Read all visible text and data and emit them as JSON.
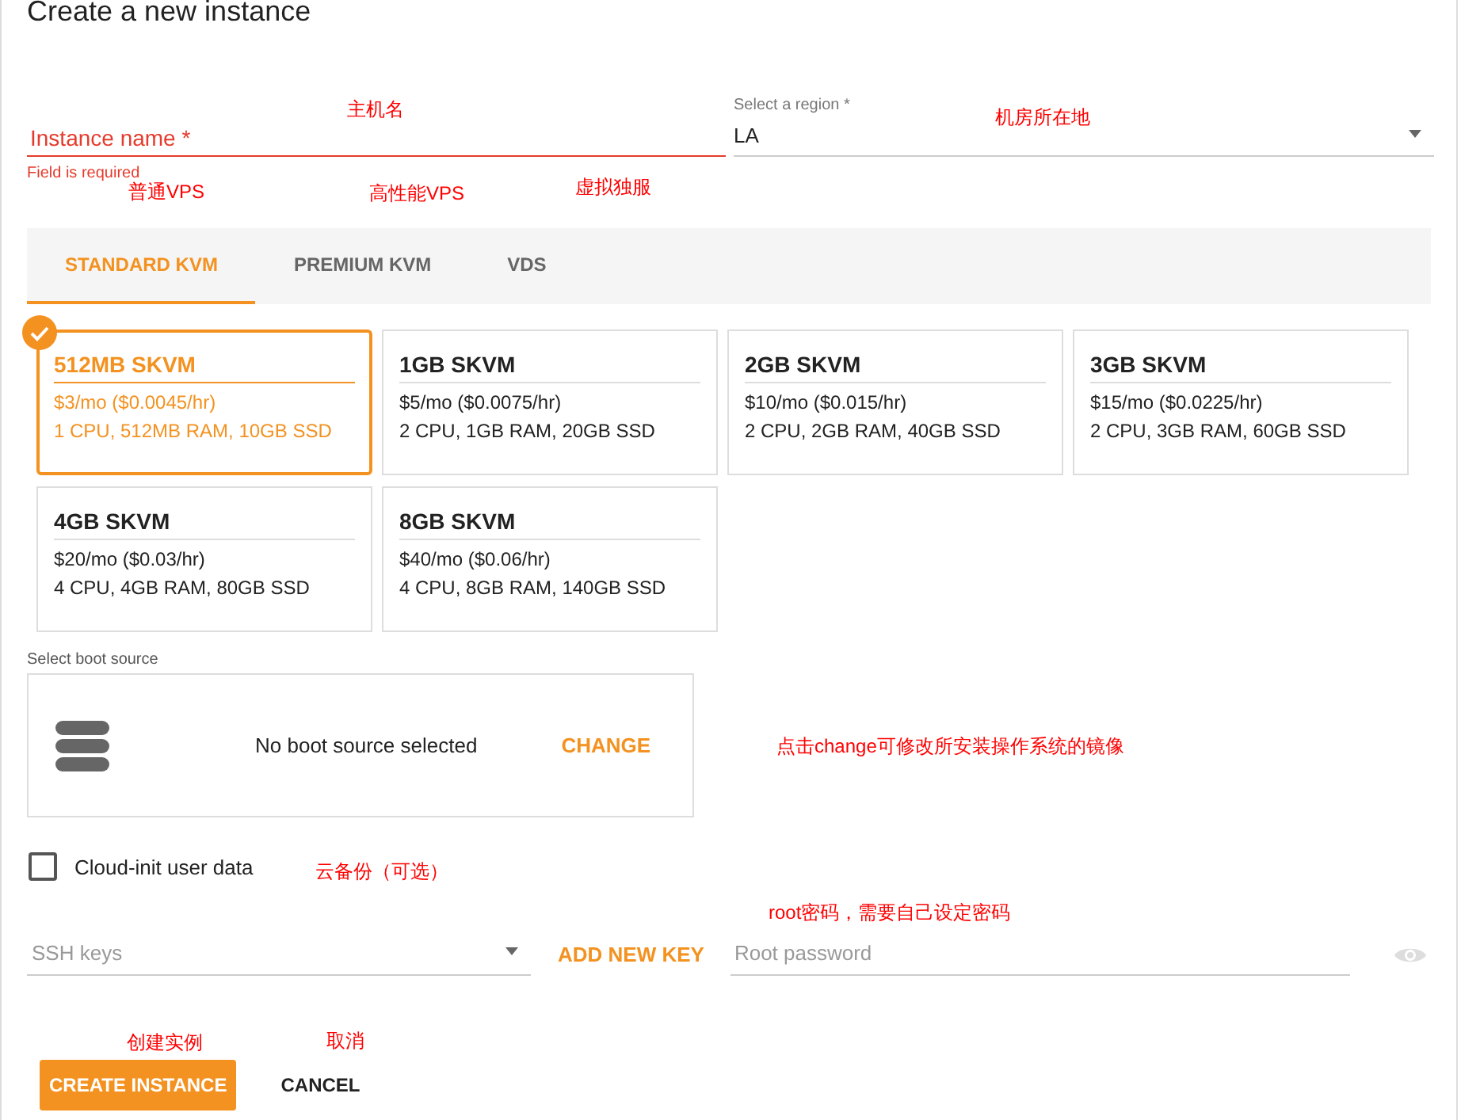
{
  "title": "Create a new instance",
  "instance_name": {
    "label": "Instance name *",
    "error": "Field is required"
  },
  "region": {
    "label": "Select a region *",
    "value": "LA"
  },
  "tabs": [
    {
      "label": "STANDARD KVM",
      "selected": true
    },
    {
      "label": "PREMIUM KVM",
      "selected": false
    },
    {
      "label": "VDS",
      "selected": false
    }
  ],
  "plans": [
    {
      "name": "512MB SKVM",
      "price": "$3/mo ($0.0045/hr)",
      "specs": "1 CPU, 512MB RAM, 10GB SSD",
      "selected": true
    },
    {
      "name": "1GB SKVM",
      "price": "$5/mo ($0.0075/hr)",
      "specs": "2 CPU, 1GB RAM, 20GB SSD",
      "selected": false
    },
    {
      "name": "2GB SKVM",
      "price": "$10/mo ($0.015/hr)",
      "specs": "2 CPU, 2GB RAM, 40GB SSD",
      "selected": false
    },
    {
      "name": "3GB SKVM",
      "price": "$15/mo ($0.0225/hr)",
      "specs": "2 CPU, 3GB RAM, 60GB SSD",
      "selected": false
    },
    {
      "name": "4GB SKVM",
      "price": "$20/mo ($0.03/hr)",
      "specs": "4 CPU, 4GB RAM, 80GB SSD",
      "selected": false
    },
    {
      "name": "8GB SKVM",
      "price": "$40/mo ($0.06/hr)",
      "specs": "4 CPU, 8GB RAM, 140GB SSD",
      "selected": false
    }
  ],
  "boot_source": {
    "label": "Select boot source",
    "text": "No boot source selected",
    "action": "CHANGE"
  },
  "cloud_init": {
    "label": "Cloud-init user data",
    "checked": false
  },
  "ssh_keys": {
    "placeholder": "SSH keys"
  },
  "add_key": "ADD NEW KEY",
  "root_password": {
    "placeholder": "Root password"
  },
  "buttons": [
    {
      "label": "CREATE INSTANCE",
      "kind": "primary"
    },
    {
      "label": "CANCEL",
      "kind": "text"
    }
  ],
  "annotations": [
    {
      "text": "主机名"
    },
    {
      "text": "机房所在地"
    },
    {
      "text": "普通VPS"
    },
    {
      "text": "高性能VPS"
    },
    {
      "text": "虚拟独服"
    },
    {
      "text": "点击change可修改所安装操作系统的镜像"
    },
    {
      "text": "云备份（可选）"
    },
    {
      "text": "root密码，需要自己设定密码"
    },
    {
      "text": "创建实例"
    },
    {
      "text": "取消"
    }
  ]
}
